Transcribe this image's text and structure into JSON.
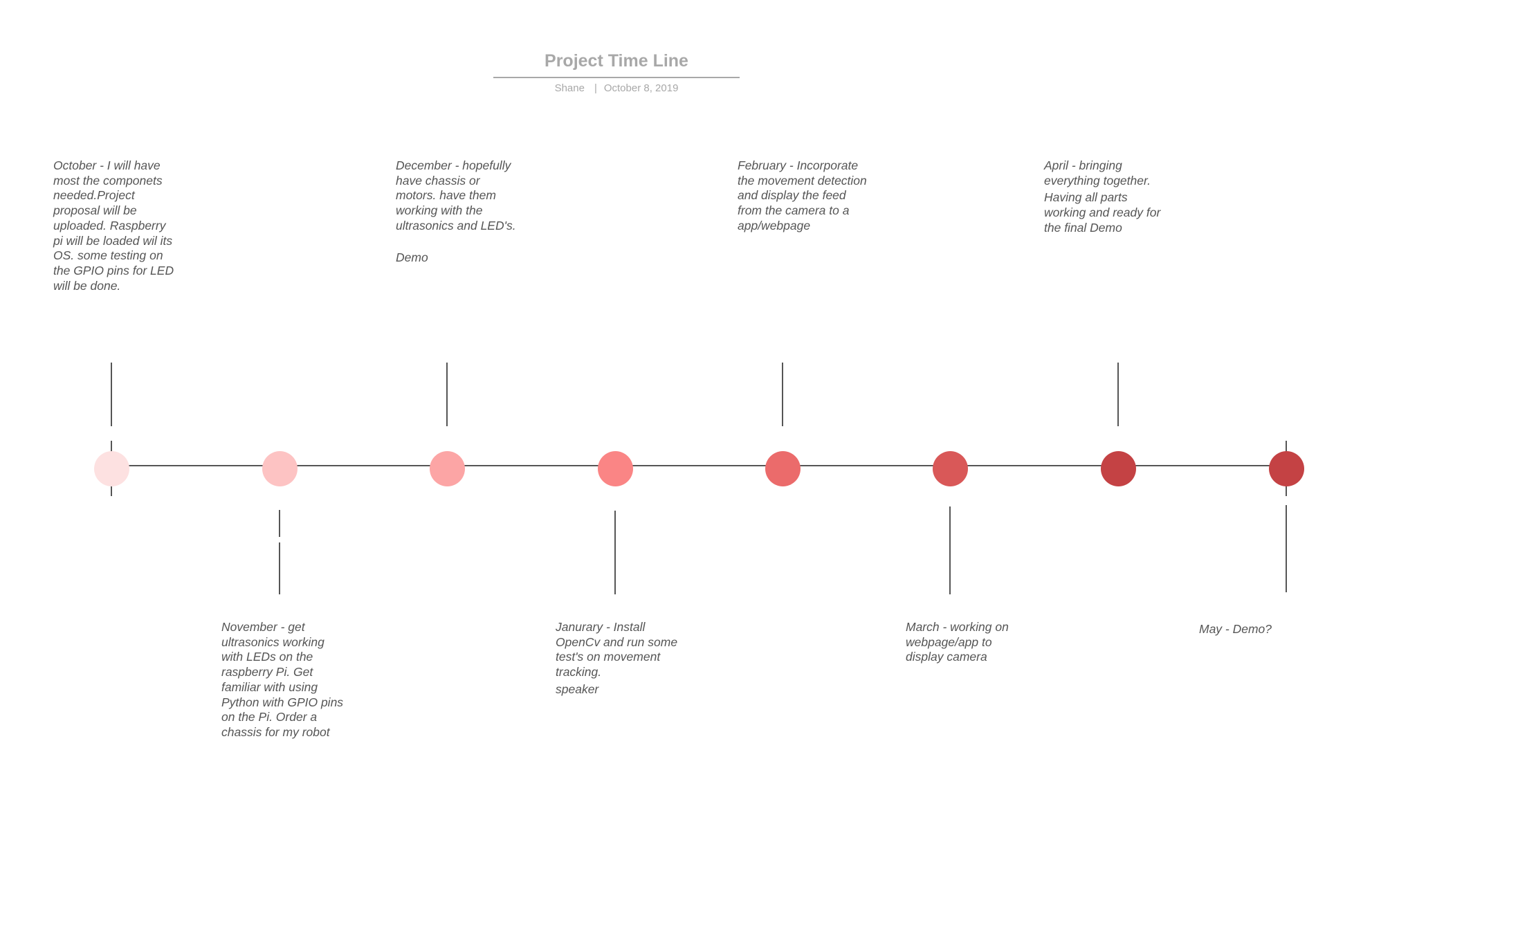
{
  "header": {
    "title": "Project Time Line",
    "author": "Shane",
    "separator": "|",
    "date": "October 8, 2019"
  },
  "milestones": [
    {
      "color": "#fde1e1",
      "lines": [
        "October - I will have most the componets needed.Project proposal will be uploaded. Raspberry pi will be loaded wil its OS. some testing on the GPIO pins for LED will be done."
      ]
    },
    {
      "color": "#fdc3c3",
      "lines": [
        "November - get ultrasonics working with LEDs on the raspberry Pi. Get familiar with using Python with GPIO pins on the Pi. Order a chassis for my robot"
      ]
    },
    {
      "color": "#fca5a5",
      "lines": [
        "December - hopefully have chassis or motors. have them working with the ultrasonics and LED's.",
        "Demo"
      ]
    },
    {
      "color": "#fa8585",
      "lines": [
        "Janurary - Install OpenCv and run some test's on movement tracking.",
        "speaker"
      ]
    },
    {
      "color": "#eb6b6b",
      "lines": [
        "February - Incorporate the movement detection and display the feed from the camera to a app/webpage"
      ]
    },
    {
      "color": "#d95858",
      "lines": [
        "March - working on webpage/app to display camera"
      ]
    },
    {
      "color": "#c44244",
      "lines": [
        "April - bringing everything together.",
        "Having all parts working and ready for the final Demo"
      ]
    },
    {
      "color": "#c44244",
      "lines": [
        "May - Demo?"
      ]
    }
  ]
}
